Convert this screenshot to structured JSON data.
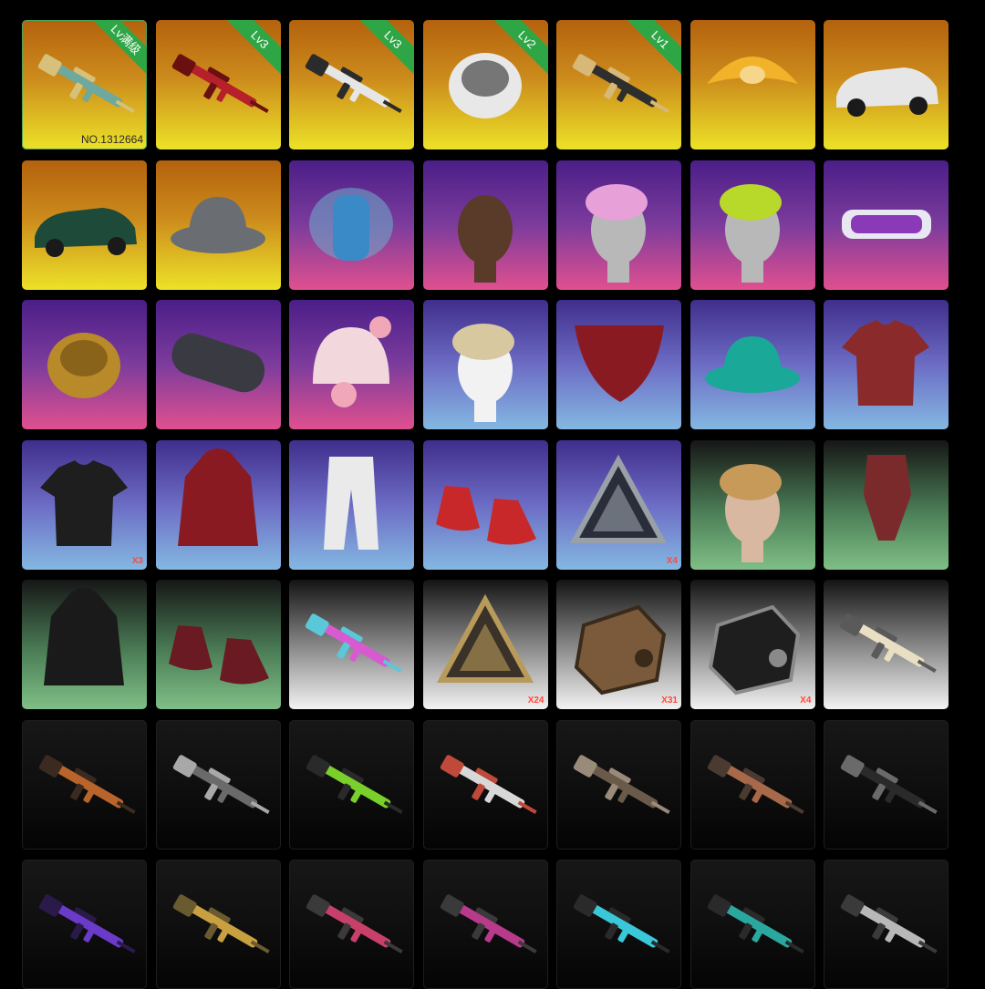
{
  "items": [
    {
      "icon": "akm-rifle-skin-icon",
      "rarity": "gold",
      "badge": "Lv满级",
      "serial": "NO.1312664",
      "selected": true
    },
    {
      "icon": "m416-red-rifle-skin-icon",
      "rarity": "gold",
      "badge": "Lv3"
    },
    {
      "icon": "scar-white-rifle-skin-icon",
      "rarity": "gold",
      "badge": "Lv3"
    },
    {
      "icon": "oni-mask-helmet-icon",
      "rarity": "gold",
      "badge": "Lv2"
    },
    {
      "icon": "ump-smg-skin-icon",
      "rarity": "gold",
      "badge": "Lv1"
    },
    {
      "icon": "parachute-icon",
      "rarity": "gold"
    },
    {
      "icon": "white-sports-car-icon",
      "rarity": "gold"
    },
    {
      "icon": "green-suv-car-icon",
      "rarity": "gold"
    },
    {
      "icon": "bucket-hat-headset-icon",
      "rarity": "gold"
    },
    {
      "icon": "smoke-grenade-icon",
      "rarity": "purple"
    },
    {
      "icon": "face-head-icon",
      "rarity": "purple"
    },
    {
      "icon": "pink-hair-icon",
      "rarity": "purple"
    },
    {
      "icon": "green-hair-icon",
      "rarity": "purple"
    },
    {
      "icon": "purple-goggles-icon",
      "rarity": "purple"
    },
    {
      "icon": "gold-mask-icon",
      "rarity": "purple"
    },
    {
      "icon": "headband-icon",
      "rarity": "purple"
    },
    {
      "icon": "pink-beanie-icon",
      "rarity": "purple"
    },
    {
      "icon": "skull-face-paint-icon",
      "rarity": "blue"
    },
    {
      "icon": "red-bandana-icon",
      "rarity": "blue"
    },
    {
      "icon": "teal-bucket-hat-icon",
      "rarity": "blue"
    },
    {
      "icon": "red-tshirt-icon",
      "rarity": "blue"
    },
    {
      "icon": "black-tshirt-icon",
      "rarity": "blue",
      "count": "X3"
    },
    {
      "icon": "red-jacket-icon",
      "rarity": "blue"
    },
    {
      "icon": "white-pants-icon",
      "rarity": "blue"
    },
    {
      "icon": "red-sneakers-icon",
      "rarity": "blue"
    },
    {
      "icon": "triangle-crate-icon",
      "rarity": "blue",
      "count": "X4"
    },
    {
      "icon": "ponytail-hair-icon",
      "rarity": "green"
    },
    {
      "icon": "scarf-icon",
      "rarity": "green"
    },
    {
      "icon": "black-coat-icon",
      "rarity": "green"
    },
    {
      "icon": "red-boots-icon",
      "rarity": "green"
    },
    {
      "icon": "rainbow-rifle-icon",
      "rarity": "white"
    },
    {
      "icon": "gold-triangle-crate-icon",
      "rarity": "white",
      "count": "X24"
    },
    {
      "icon": "bronze-crate-icon",
      "rarity": "white",
      "count": "X31"
    },
    {
      "icon": "black-crate-icon",
      "rarity": "white",
      "count": "X4"
    },
    {
      "icon": "cream-rifle-icon",
      "rarity": "white"
    },
    {
      "icon": "m16-orange-rifle-icon",
      "rarity": "dark"
    },
    {
      "icon": "gray-rifle-icon",
      "rarity": "dark"
    },
    {
      "icon": "neon-green-rifle-icon",
      "rarity": "dark"
    },
    {
      "icon": "white-red-rifle-icon",
      "rarity": "dark"
    },
    {
      "icon": "camo-rifle-icon",
      "rarity": "dark"
    },
    {
      "icon": "copper-smg-icon",
      "rarity": "dark"
    },
    {
      "icon": "black-akm-icon",
      "rarity": "dark"
    },
    {
      "icon": "purple-smg-icon",
      "rarity": "dark"
    },
    {
      "icon": "crossbow-icon",
      "rarity": "dark"
    },
    {
      "icon": "pink-rifle-icon",
      "rarity": "dark"
    },
    {
      "icon": "magenta-rifle-icon",
      "rarity": "dark"
    },
    {
      "icon": "cyan-rifle-icon",
      "rarity": "dark"
    },
    {
      "icon": "teal-rifle-icon",
      "rarity": "dark"
    },
    {
      "icon": "silver-rifle-icon",
      "rarity": "dark"
    }
  ]
}
